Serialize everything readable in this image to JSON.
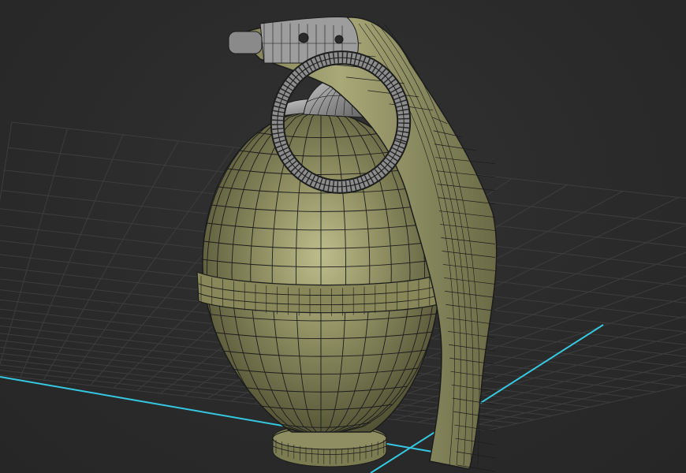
{
  "viewport": {
    "background": "#2b2b2b",
    "grid_color": "#3d3d3d",
    "grid_line_count": 22,
    "axis_color": "#35c8e0"
  },
  "model": {
    "name_icon": "grenade-mesh",
    "body_color": "#8a8a5e",
    "body_highlight": "#b3b384",
    "body_shadow": "#4f4f33",
    "metal_color": "#9a9a9a",
    "metal_dark": "#5e5e5e",
    "wire_color": "#1c1c1c",
    "wireframe": true
  }
}
